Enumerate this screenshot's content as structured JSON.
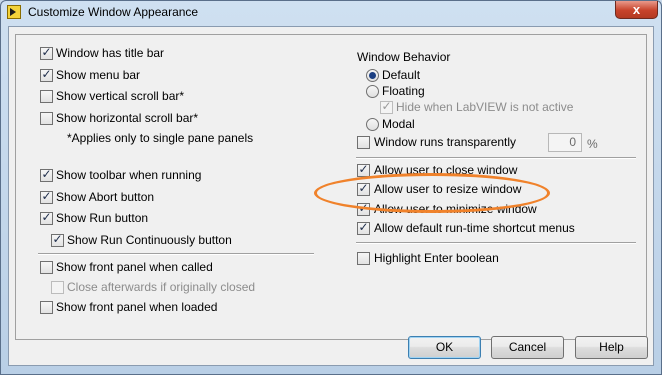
{
  "window": {
    "title": "Customize Window Appearance",
    "close_glyph": "x"
  },
  "left": {
    "window_has_title_bar": {
      "label": "Window has title bar",
      "checked": true
    },
    "show_menu_bar": {
      "label": "Show menu bar",
      "checked": true
    },
    "show_vertical_scroll_bar": {
      "label": "Show vertical scroll bar*",
      "checked": false
    },
    "show_horizontal_scroll_bar": {
      "label": "Show horizontal scroll bar*",
      "checked": false
    },
    "scroll_note": "*Applies only to single pane panels",
    "show_toolbar_when_running": {
      "label": "Show toolbar when running",
      "checked": true
    },
    "show_abort_button": {
      "label": "Show Abort button",
      "checked": true
    },
    "show_run_button": {
      "label": "Show Run button",
      "checked": true
    },
    "show_run_continuously_button": {
      "label": "Show Run Continuously button",
      "checked": true
    },
    "show_front_panel_when_called": {
      "label": "Show front panel when called",
      "checked": false
    },
    "close_afterwards": {
      "label": "Close afterwards if originally closed",
      "checked": false,
      "disabled": true
    },
    "show_front_panel_when_loaded": {
      "label": "Show front panel when loaded",
      "checked": false
    }
  },
  "right": {
    "window_behavior_heading": "Window Behavior",
    "behavior_default": {
      "label": "Default",
      "selected": true
    },
    "behavior_floating": {
      "label": "Floating",
      "selected": false
    },
    "hide_when_inactive": {
      "label": "Hide when LabVIEW is not active",
      "checked": true,
      "disabled": true
    },
    "behavior_modal": {
      "label": "Modal",
      "selected": false
    },
    "window_runs_transparently": {
      "label": "Window runs transparently",
      "checked": false
    },
    "transparency_value": "0",
    "transparency_unit": "%",
    "allow_user_close": {
      "label": "Allow user to close window",
      "checked": true
    },
    "allow_user_resize": {
      "label": "Allow user to resize window",
      "checked": true
    },
    "allow_user_minimize": {
      "label": "Allow user to minimize window",
      "checked": true
    },
    "allow_default_menus": {
      "label": "Allow default run-time shortcut menus",
      "checked": true
    },
    "highlight_enter_boolean": {
      "label": "Highlight Enter boolean",
      "checked": false
    }
  },
  "buttons": {
    "ok": "OK",
    "cancel": "Cancel",
    "help": "Help"
  },
  "annotation_color": "#f0822b"
}
